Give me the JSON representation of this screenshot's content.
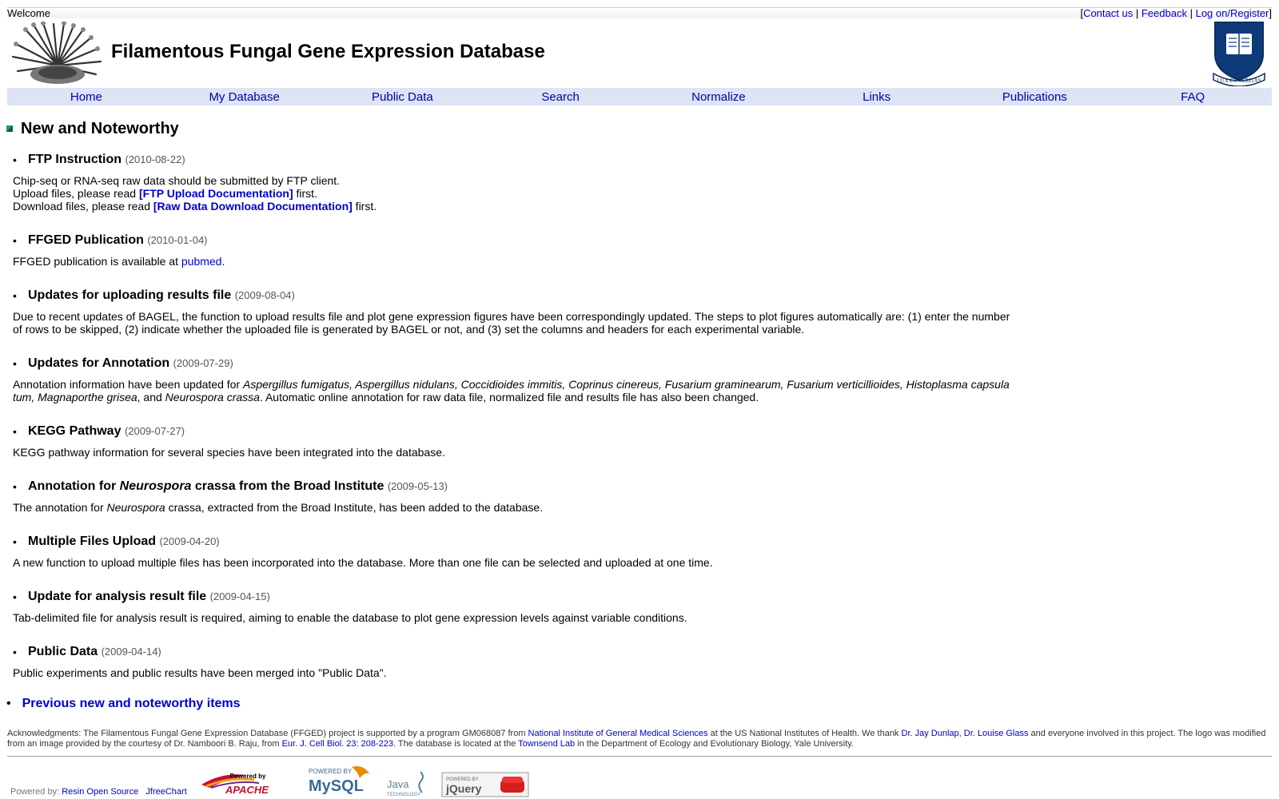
{
  "topbar": {
    "welcome": "Welcome",
    "bracket_open": "[",
    "bracket_close": "]",
    "separator": "|",
    "contact": "Contact us",
    "feedback": "Feedback",
    "login": "Log on/Register"
  },
  "header": {
    "title": "Filamentous Fungal Gene Expression Database",
    "crest_text": "LUX ET VERITAS"
  },
  "nav": [
    "Home",
    "My Database",
    "Public Data",
    "Search",
    "Normalize",
    "Links",
    "Publications",
    "FAQ"
  ],
  "section_title": "New and Noteworthy",
  "news": [
    {
      "title": "FTP Instruction",
      "date": "(2010-08-22)",
      "line1": "Chip-seq or RNA-seq raw data should be submitted by FTP client.",
      "line2_pre": "Upload files, please read ",
      "line2_link": "[FTP Upload Documentation]",
      "line2_post": " first.",
      "line3_pre": "Download files, please read ",
      "line3_link": "[Raw Data Download Documentation]",
      "line3_post": " first."
    },
    {
      "title": "FFGED Publication",
      "date": "(2010-01-04)",
      "body_pre": "FFGED publication is available at ",
      "body_link": "pubmed",
      "body_post": "."
    },
    {
      "title": "Updates for uploading results file",
      "date": "(2009-08-04)",
      "body": "Due to recent updates of BAGEL, the function to upload results file and plot gene expression figures have been correspondingly updated. The steps to plot figures automatically are: (1) enter the number of rows to be skipped, (2) indicate whether the uploaded file is generated by BAGEL or not, and (3) set the columns and headers for each experimental variable."
    },
    {
      "title": "Updates for Annotation",
      "date": "(2009-07-29)",
      "body_pre": "Annotation information have been updated for ",
      "body_species": "Aspergillus fumigatus, Aspergillus nidulans, Coccidioides immitis, Coprinus cinereus, Fusarium graminearum, Fusarium verticillioides, Histoplasma capsula tum, Magnaporthe grisea",
      "body_and": ", and ",
      "body_species2": "Neurospora crassa",
      "body_post": ". Automatic online annotation for raw data file, normalized file and results file has also been changed."
    },
    {
      "title": "KEGG Pathway",
      "date": "(2009-07-27)",
      "body": "KEGG pathway information for several species have been integrated into the database."
    },
    {
      "title_pre": "Annotation for ",
      "title_ital": "Neurospora",
      "title_post": " crassa from the Broad Institute",
      "date": "(2009-05-13)",
      "body_pre": "The annotation for ",
      "body_ital": "Neurospora",
      "body_post": " crassa, extracted from the Broad Institute, has been added to the database."
    },
    {
      "title": "Multiple Files Upload",
      "date": "(2009-04-20)",
      "body": "A new function to upload multiple files has been incorporated into the database. More than one file can be selected and uploaded at one time."
    },
    {
      "title": "Update for analysis result file",
      "date": "(2009-04-15)",
      "body": "Tab-delimited file for analysis result is required, aiming to enable the database to plot gene expression levels against variable conditions."
    },
    {
      "title": "Public Data",
      "date": "(2009-04-14)",
      "body": "Public experiments and public results have been merged into \"Public Data\"."
    }
  ],
  "previous_link": "Previous new and noteworthy items",
  "ack": {
    "t1": "Acknowledgments: The Filamentous Fungal Gene Expression Database (FFGED) project is supported by a program GM068087 from ",
    "l1": "National Institute of General Medical Sciences",
    "t2": " at the US National Institutes of Health. We thank ",
    "l2": "Dr. Jay Dunlap",
    "t3": ", ",
    "l3": "Dr. Louise Glass",
    "t4": " and everyone involved in this project. The logo was modified from an image provided by the courtesy of Dr. Namboori B. Raju, from ",
    "l4": "Eur. J. Cell Biol. 23: 208-223",
    "t5": ". The database is located at the ",
    "l5": "Townsend Lab",
    "t6": " in the Department of Ecology and Evolutionary Biology, Yale University."
  },
  "footer": {
    "powered_by": "Powered by:",
    "resin": "Resin Open Source",
    "jfree": "JfreeChart",
    "apache_small": "Powered by",
    "apache": "APACHE",
    "mysql_small": "POWERED BY",
    "mysql": "MySQL",
    "java": "Java",
    "java_small": "TECHNOLOGY",
    "jquery_small": "POWERED BY",
    "jquery": "jQuery"
  }
}
